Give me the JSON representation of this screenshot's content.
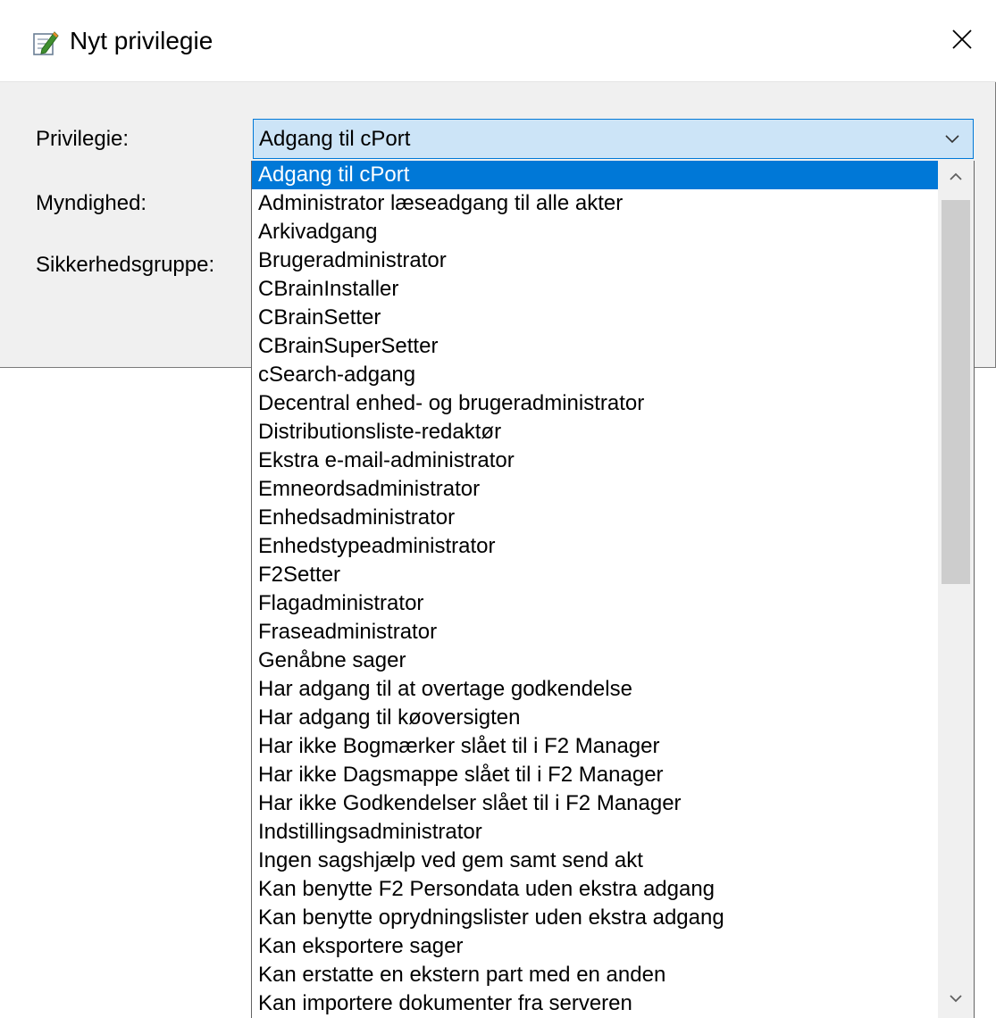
{
  "window": {
    "title": "Nyt privilegie",
    "title_icon": "edit-document-icon",
    "close_icon": "close-icon"
  },
  "form": {
    "privilege_label": "Privilegie:",
    "authority_label": "Myndighed:",
    "security_group_label": "Sikkerhedsgruppe:",
    "privilege_value": "Adgang til cPort"
  },
  "dropdown": {
    "selected_index": 0,
    "items": [
      "Adgang til cPort",
      "Administrator læseadgang til alle akter",
      "Arkivadgang",
      "Brugeradministrator",
      "CBrainInstaller",
      "CBrainSetter",
      "CBrainSuperSetter",
      "cSearch-adgang",
      "Decentral enhed- og brugeradministrator",
      "Distributionsliste-redaktør",
      "Ekstra e-mail-administrator",
      "Emneordsadministrator",
      "Enhedsadministrator",
      "Enhedstypeadministrator",
      "F2Setter",
      "Flagadministrator",
      "Fraseadministrator",
      "Genåbne sager",
      "Har adgang til at overtage godkendelse",
      "Har adgang til køoversigten",
      "Har ikke Bogmærker slået til i F2 Manager",
      "Har ikke Dagsmappe slået til i F2 Manager",
      "Har ikke Godkendelser slået til i F2 Manager",
      "Indstillingsadministrator",
      "Ingen sagshjælp ved gem samt send akt",
      "Kan benytte F2 Persondata uden ekstra adgang",
      "Kan benytte oprydningslister uden ekstra adgang",
      "Kan eksportere sager",
      "Kan erstatte en ekstern part med en anden",
      "Kan importere dokumenter fra serveren"
    ]
  },
  "colors": {
    "selection": "#0078d7",
    "combo_background": "#cce4f7",
    "dialog_background": "#f0f0f0"
  }
}
